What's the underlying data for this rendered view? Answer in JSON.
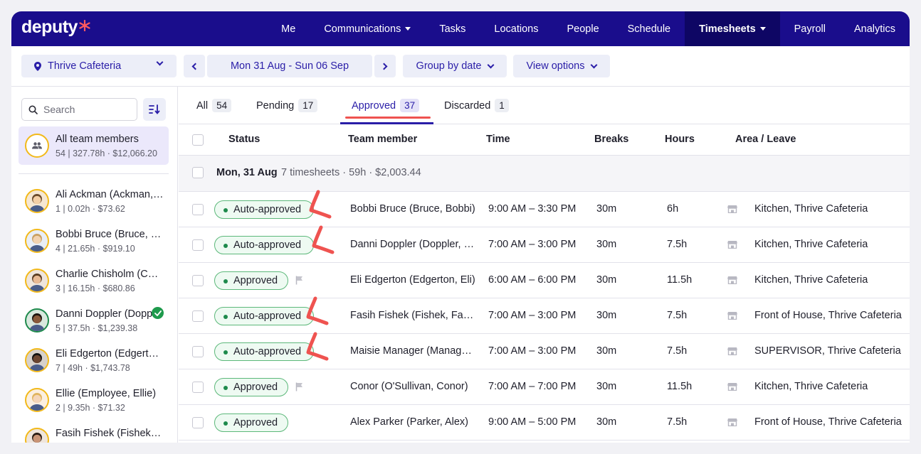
{
  "logo": "deputy",
  "nav": {
    "items": [
      {
        "label": "Me"
      },
      {
        "label": "Communications",
        "dropdown": true
      },
      {
        "label": "Tasks"
      },
      {
        "label": "Locations"
      },
      {
        "label": "People"
      },
      {
        "label": "Schedule"
      },
      {
        "label": "Timesheets",
        "dropdown": true,
        "active": true
      },
      {
        "label": "Payroll"
      },
      {
        "label": "Analytics"
      }
    ]
  },
  "toolbar": {
    "location": "Thrive Cafeteria",
    "date_range": "Mon 31 Aug - Sun 06 Sep",
    "group_by": "Group by date",
    "view_options": "View options"
  },
  "sidebar": {
    "search_placeholder": "Search",
    "all_team": {
      "name": "All team members",
      "stats": "54 | 327.78h · $12,066.20"
    },
    "members": [
      {
        "name": "Ali Ackman (Ackman, Ali)",
        "stats": "1 | 0.02h · $73.62"
      },
      {
        "name": "Bobbi Bruce (Bruce, Bobbi)",
        "stats": "4 | 21.65h · $919.10"
      },
      {
        "name": "Charlie Chisholm (Chisholm, Charlie)",
        "stats": "3 | 16.15h · $680.86"
      },
      {
        "name": "Danni Doppler (Doppler, Danni)",
        "stats": "5 | 37.5h · $1,239.38",
        "verified": true
      },
      {
        "name": "Eli Edgerton (Edgerton, Eli)",
        "stats": "7 | 49h · $1,743.78"
      },
      {
        "name": "Ellie (Employee, Ellie)",
        "stats": "2 | 9.35h · $71.32"
      },
      {
        "name": "Fasih Fishek (Fishek, Fasih)",
        "stats": "4 | 13.43h · $498.38"
      }
    ]
  },
  "tabs": [
    {
      "label": "All",
      "count": "54"
    },
    {
      "label": "Pending",
      "count": "17"
    },
    {
      "label": "Approved",
      "count": "37",
      "active": true
    },
    {
      "label": "Discarded",
      "count": "1"
    }
  ],
  "table": {
    "headers": {
      "status": "Status",
      "member": "Team member",
      "time": "Time",
      "breaks": "Breaks",
      "hours": "Hours",
      "area": "Area / Leave"
    },
    "group": {
      "date": "Mon, 31 Aug",
      "summary": "7 timesheets · 59h · $2,003.44"
    },
    "rows": [
      {
        "status": "Auto-approved",
        "member": "Bobbi Bruce (Bruce, Bobbi)",
        "time": "9:00 AM – 3:30 PM",
        "breaks": "30m",
        "hours": "6h",
        "area": "Kitchen, Thrive Cafeteria",
        "flag": false,
        "marked": true
      },
      {
        "status": "Auto-approved",
        "member": "Danni Doppler (Doppler, Danni)",
        "time": "7:00 AM – 3:00 PM",
        "breaks": "30m",
        "hours": "7.5h",
        "area": "Kitchen, Thrive Cafeteria",
        "flag": false,
        "marked": true
      },
      {
        "status": "Approved",
        "member": "Eli Edgerton (Edgerton, Eli)",
        "time": "6:00 AM – 6:00 PM",
        "breaks": "30m",
        "hours": "11.5h",
        "area": "Kitchen, Thrive Cafeteria",
        "flag": true,
        "marked": false
      },
      {
        "status": "Auto-approved",
        "member": "Fasih Fishek (Fishek, Fasih)",
        "time": "7:00 AM – 3:00 PM",
        "breaks": "30m",
        "hours": "7.5h",
        "area": "Front of House, Thrive Cafeteria",
        "flag": false,
        "marked": true
      },
      {
        "status": "Auto-approved",
        "member": "Maisie Manager (Manager, Maisie)",
        "time": "7:00 AM – 3:00 PM",
        "breaks": "30m",
        "hours": "7.5h",
        "area": "SUPERVISOR, Thrive Cafeteria",
        "flag": false,
        "marked": true
      },
      {
        "status": "Approved",
        "member": "Conor (O'Sullivan, Conor)",
        "time": "7:00 AM – 7:00 PM",
        "breaks": "30m",
        "hours": "11.5h",
        "area": "Kitchen, Thrive Cafeteria",
        "flag": true,
        "marked": false
      },
      {
        "status": "Approved",
        "member": "Alex Parker (Parker, Alex)",
        "time": "9:00 AM – 5:00 PM",
        "breaks": "30m",
        "hours": "7.5h",
        "area": "Front of House, Thrive Cafeteria",
        "flag": false,
        "marked": false
      }
    ]
  },
  "colors": {
    "nav_bg": "#1a0d8c",
    "nav_active": "#0e0664",
    "accent": "#2a1ea8",
    "annotation_red": "#ef5350",
    "status_green": "#1e8a4c"
  }
}
